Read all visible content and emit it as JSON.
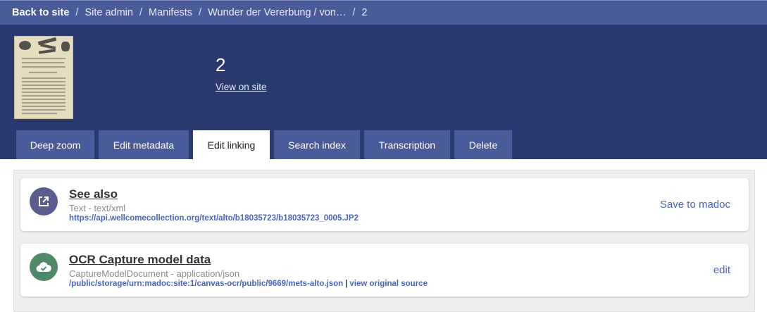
{
  "breadcrumb": {
    "back": "Back to site",
    "items": [
      "Site admin",
      "Manifests",
      "Wunder der Vererbung / von…",
      "2"
    ]
  },
  "header": {
    "title": "2",
    "view_link": "View on site"
  },
  "tabs": [
    {
      "label": "Deep zoom",
      "active": false
    },
    {
      "label": "Edit metadata",
      "active": false
    },
    {
      "label": "Edit linking",
      "active": true
    },
    {
      "label": "Search index",
      "active": false
    },
    {
      "label": "Transcription",
      "active": false
    },
    {
      "label": "Delete",
      "active": false
    }
  ],
  "links": [
    {
      "title": "See also",
      "subtitle": "Text - text/xml",
      "url": "https://api.wellcomecollection.org/text/alto/b18035723/b18035723_0005.JP2",
      "action": "Save to madoc",
      "icon": "external-link-icon",
      "icon_color": "#5a5e8e"
    },
    {
      "title": "OCR Capture model data",
      "subtitle": "CaptureModelDocument - application/json",
      "url": "/public/storage/urn:madoc:site:1/canvas-ocr/public/9669/mets-alto.json",
      "extra_link": "view original source",
      "action": "edit",
      "icon": "cloud-check-icon",
      "icon_color": "#4e8a68"
    }
  ],
  "colors": {
    "topbar": "#4a5b9a",
    "header": "#2b3a6e",
    "link": "#4a62c4"
  }
}
